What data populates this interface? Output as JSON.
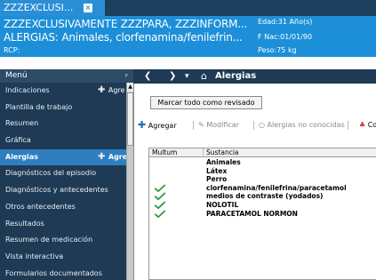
{
  "window": {
    "tab_title": "ZZZEXCLUSI...",
    "tab_close": "×"
  },
  "banner": {
    "patient_name": "ZZZEXCLUSIVAMENTE ZZZPARA, ZZZINFORM...",
    "allergies": "ALERGIAS: Animales, clorfenamina/fenilefrin...",
    "rcp": "RCP:",
    "age": "Edad:31 Año(s)",
    "dob": "F Nac:01/01/90",
    "weight": "Peso:75 kg"
  },
  "sidebar": {
    "header": "Menú",
    "pin": "ᵖ",
    "add_label": "Agre",
    "items": [
      {
        "label": "Indicaciones",
        "active": false,
        "add": true
      },
      {
        "label": "Plantilla de trabajo",
        "active": false,
        "add": false
      },
      {
        "label": "Resumen",
        "active": false,
        "add": false
      },
      {
        "label": "Gráfica",
        "active": false,
        "add": false
      },
      {
        "label": "Alergias",
        "active": true,
        "add": true
      },
      {
        "label": "Diagnósticos del episodio",
        "active": false,
        "add": false
      },
      {
        "label": "Diagnósticos y antecedentes",
        "active": false,
        "add": false
      },
      {
        "label": "Otros antecedentes",
        "active": false,
        "add": false
      },
      {
        "label": "Resultados",
        "active": false,
        "add": false
      },
      {
        "label": "Resumen de medicación",
        "active": false,
        "add": false
      },
      {
        "label": "Vista interactiva",
        "active": false,
        "add": false
      },
      {
        "label": "Formularios documentados",
        "active": false,
        "add": false
      }
    ]
  },
  "main": {
    "title": "Alergias",
    "back_icon": "❮",
    "forward_icon": "❯",
    "dropdown_icon": "▾",
    "home_icon": "⌂",
    "mark_reviewed": "Marcar todo como revisado",
    "toolbar": {
      "add": "Agregar",
      "modify": "Modificar",
      "unknown": "Alergias no conocidas",
      "co": "Co"
    },
    "table": {
      "headers": [
        "Multum",
        "Sustancia"
      ],
      "rows": [
        {
          "multum": false,
          "substance": "Animales"
        },
        {
          "multum": false,
          "substance": "Látex"
        },
        {
          "multum": false,
          "substance": "Perro"
        },
        {
          "multum": true,
          "substance": "clorfenamina/fenilefrina/paracetamol"
        },
        {
          "multum": true,
          "substance": "medios de contraste (yodados)"
        },
        {
          "multum": true,
          "substance": "NOLOTIL"
        },
        {
          "multum": true,
          "substance": "PARACETAMOL NORMON"
        }
      ]
    }
  },
  "colors": {
    "banner": "#1d8fd8",
    "sidebar": "#1e3a55",
    "active_item": "#2f7fc0",
    "check": "#2a9a3a"
  }
}
